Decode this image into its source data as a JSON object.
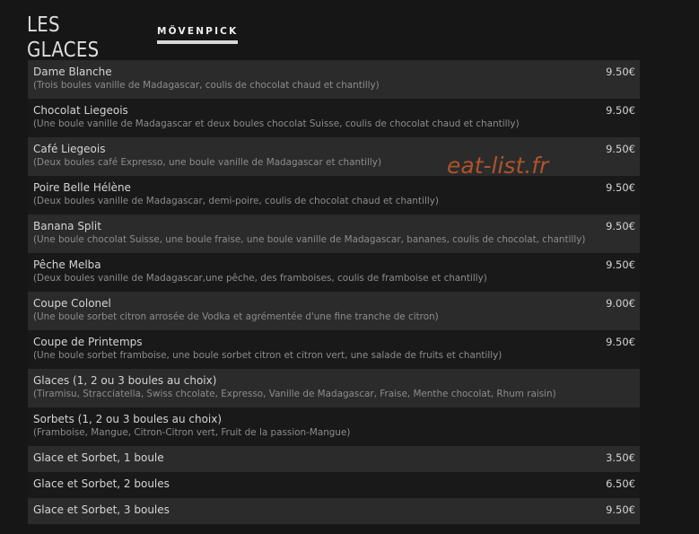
{
  "header": {
    "title": "LES GLACES",
    "brand": "MÖVENPICK"
  },
  "watermark": "eat-list.fr",
  "items": [
    {
      "name": "Dame Blanche",
      "description": "(Trois boules vanille de Madagascar, coulis de chocolat chaud et chantilly)",
      "price": "9.50€"
    },
    {
      "name": "Chocolat Liegeois",
      "description": "(Une boule vanille de Madagascar et deux boules chocolat Suisse, coulis de chocolat chaud et chantilly)",
      "price": "9.50€"
    },
    {
      "name": "Café Liegeois",
      "description": "(Deux boules café Expresso, une boule vanille de Madagascar et chantilly)",
      "price": "9.50€"
    },
    {
      "name": "Poire Belle Hélène",
      "description": "(Deux boules vanille de Madagascar, demi-poire, coulis de chocolat chaud et chantilly)",
      "price": "9.50€"
    },
    {
      "name": "Banana Split",
      "description": "(Une boule chocolat Suisse, une boule fraise, une boule vanille de Madagascar, bananes, coulis de chocolat, chantilly)",
      "price": "9.50€"
    },
    {
      "name": "Pêche Melba",
      "description": "(Deux boules vanille de Madagascar,une pêche, des framboises, coulis de framboise et chantilly)",
      "price": "9.50€"
    },
    {
      "name": "Coupe Colonel",
      "description": "(Une boule sorbet citron arrosée de Vodka et agrémentée d'une fine tranche de citron)",
      "price": "9.00€"
    },
    {
      "name": "Coupe de Printemps",
      "description": "(Une boule sorbet framboise, une boule sorbet citron et citron vert, une salade de fruits et chantilly)",
      "price": "9.50€"
    },
    {
      "name": "Glaces (1, 2 ou 3 boules au choix)",
      "description": "(Tiramisu, Stracciatella, Swiss chcolate, Expresso, Vanille de Madagascar, Fraise, Menthe chocolat, Rhum raisin)",
      "price": ""
    },
    {
      "name": "Sorbets (1, 2 ou 3 boules au choix)",
      "description": "(Framboise, Mangue, Citron-Citron vert, Fruit de la passion-Mangue)",
      "price": ""
    },
    {
      "name": "Glace et Sorbet, 1 boule",
      "description": "",
      "price": "3.50€"
    },
    {
      "name": "Glace et Sorbet, 2 boules",
      "description": "",
      "price": "6.50€"
    },
    {
      "name": "Glace et Sorbet, 3 boules",
      "description": "",
      "price": "9.50€"
    }
  ]
}
